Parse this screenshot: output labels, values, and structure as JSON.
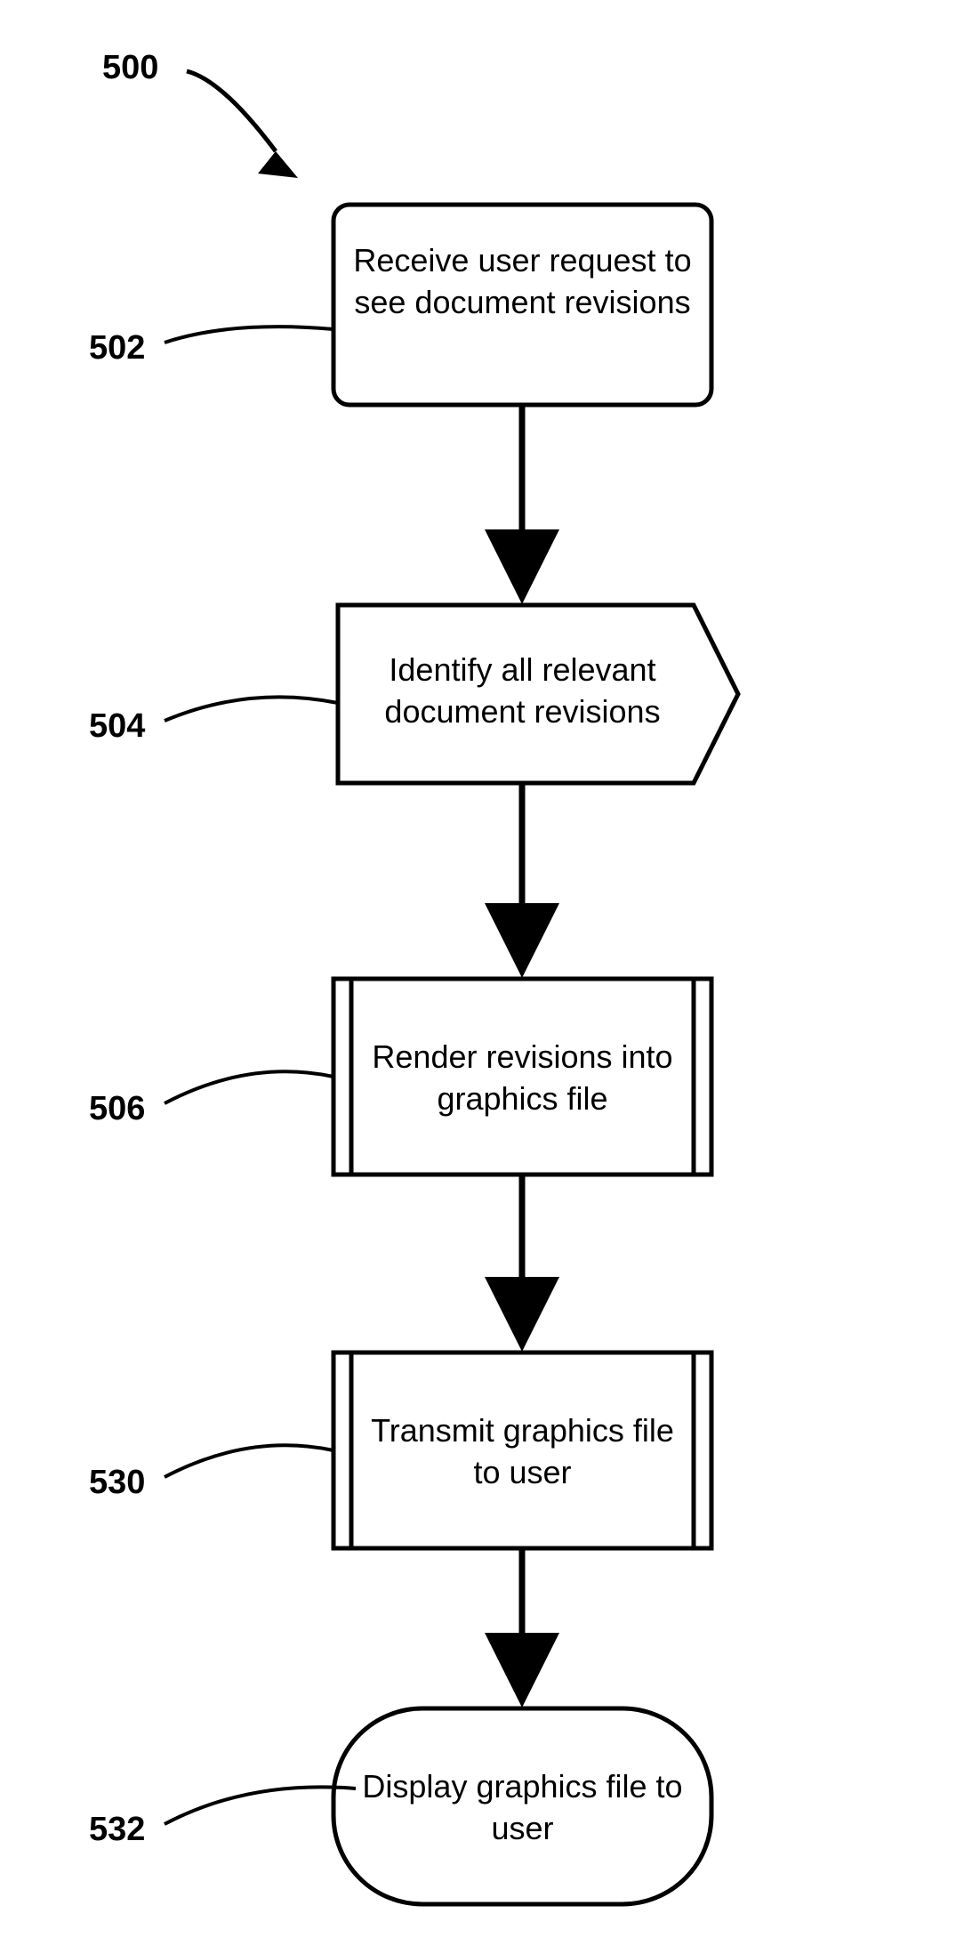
{
  "figure_label": "500",
  "nodes": [
    {
      "ref": "502",
      "text": "Receive user request to see document revisions"
    },
    {
      "ref": "504",
      "text": "Identify all relevant document revisions"
    },
    {
      "ref": "506",
      "text": "Render revisions into graphics file"
    },
    {
      "ref": "530",
      "text": "Transmit graphics file to user"
    },
    {
      "ref": "532",
      "text": "Display graphics file to user"
    }
  ]
}
